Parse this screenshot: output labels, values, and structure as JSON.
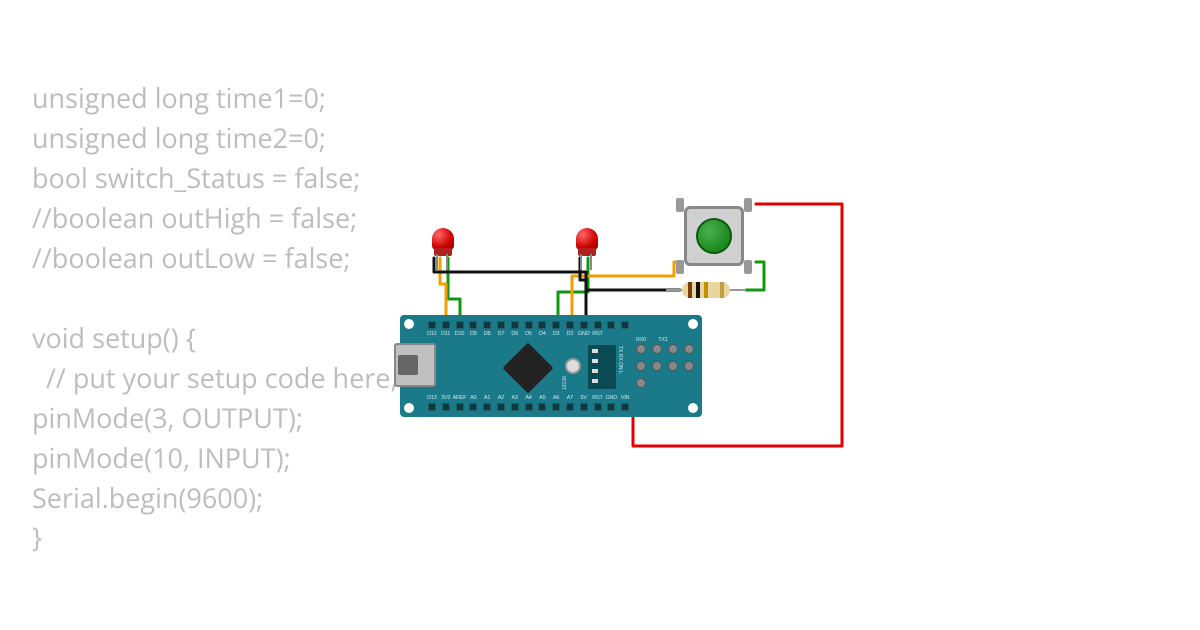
{
  "code": {
    "l1": "unsigned long time1=0;",
    "l2": "unsigned long time2=0;",
    "l3": "bool switch_Status = false;",
    "l4": "//boolean outHigh = false;",
    "l5": "//boolean outLow = false;",
    "l6": "",
    "l7": "void setup() {",
    "l8": "  // put your setup code here, to run once:",
    "l9": "pinMode(3, OUTPUT);",
    "l10": "pinMode(10, INPUT);",
    "l11": "Serial.begin(9600);",
    "l12": "}"
  },
  "board": {
    "top_labels": [
      "D12",
      "D11",
      "D10",
      "D9",
      "D8",
      "D7",
      "D6",
      "D5",
      "D4",
      "D3",
      "D2",
      "GND",
      "RST"
    ],
    "top_right_labels": [
      "RX0",
      "TX1"
    ],
    "bottom_labels": [
      "D13",
      "3V3",
      "AREF",
      "A0",
      "A1",
      "A2",
      "A3",
      "A4",
      "A5",
      "A6",
      "A7",
      "5V",
      "RST",
      "GND",
      "VIN"
    ],
    "indicator_text": "TX RX ON L",
    "reset_label": "RESET"
  },
  "components": {
    "led1": "red-led",
    "led2": "red-led",
    "button": "pushbutton-green",
    "resistor": "resistor"
  },
  "wire_colors": {
    "power": "#e00000",
    "ground": "#111111",
    "signal_a": "#f0a000",
    "signal_b": "#109810"
  },
  "resistor_bands": [
    "#7a3a10",
    "#111111",
    "#c09000",
    "#c0a040"
  ]
}
